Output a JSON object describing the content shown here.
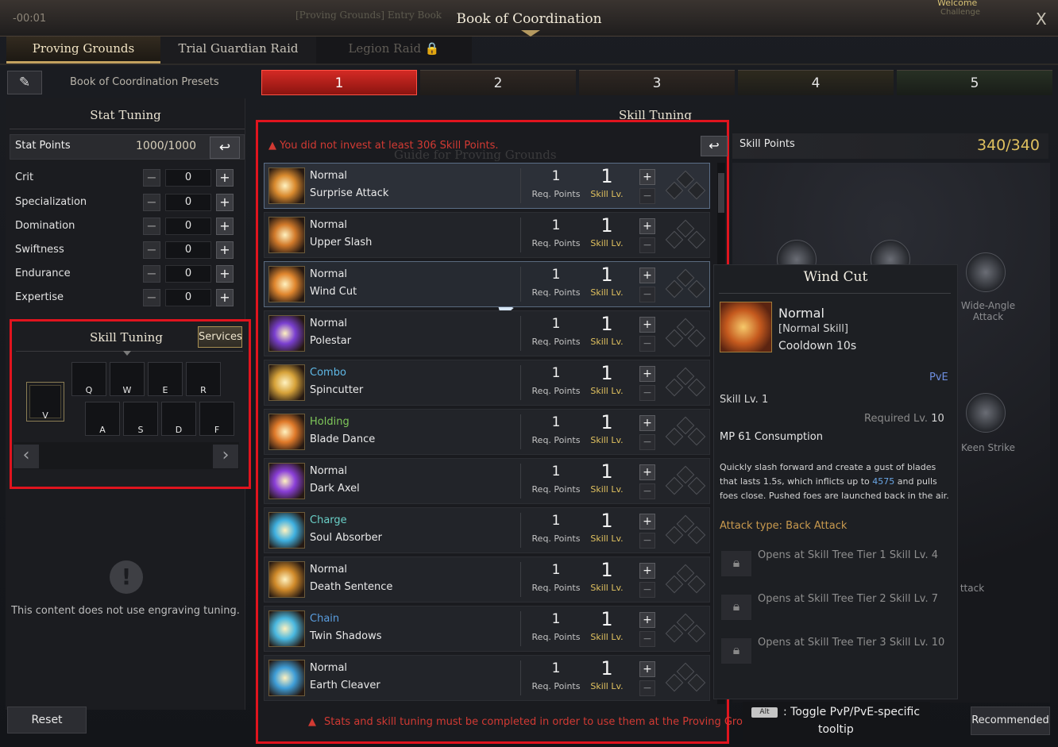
{
  "header": {
    "timer": "-00:01",
    "ghost_title": "[Proving Grounds] Entry Book",
    "title": "Book of Coordination",
    "welcome": "Welcome",
    "challenge": "Challenge",
    "close": "X"
  },
  "tabs": [
    {
      "label": "Proving Grounds"
    },
    {
      "label": "Trial Guardian Raid"
    },
    {
      "label": "Legion Raid 🔒"
    }
  ],
  "presets": {
    "label": "Book of Coordination Presets",
    "edit_icon": "pencil-edit-icon",
    "items": [
      "1",
      "2",
      "3",
      "4",
      "5"
    ],
    "selected": "1"
  },
  "stat_tuning": {
    "title": "Stat Tuning",
    "points_label": "Stat Points",
    "points_value": "1000/1000",
    "stats": [
      {
        "name": "Crit",
        "value": "0"
      },
      {
        "name": "Specialization",
        "value": "0"
      },
      {
        "name": "Domination",
        "value": "0"
      },
      {
        "name": "Swiftness",
        "value": "0"
      },
      {
        "name": "Endurance",
        "value": "0"
      },
      {
        "name": "Expertise",
        "value": "0"
      }
    ]
  },
  "left_skill_tuning": {
    "title": "Skill Tuning",
    "services": "Services",
    "keys_top": [
      "Q",
      "W",
      "E",
      "R"
    ],
    "keys_bottom": [
      "A",
      "S",
      "D",
      "F"
    ],
    "key_v": "V",
    "prev": "‹",
    "next": "›"
  },
  "engraving": {
    "message": "This content does not use engraving tuning.",
    "icon": "!"
  },
  "buttons": {
    "reset": "Reset",
    "recommended": "Recommended"
  },
  "skill_tuning": {
    "title": "Skill Tuning",
    "warning": "You did not invest at least 306 Skill Points.",
    "ghost_guide": "Guide for Proving Grounds",
    "bottom_warning": "Stats and skill tuning must be completed in order to use them at the Proving Grounds",
    "req_label": "Req. Points",
    "lv_label": "Skill Lv.",
    "skills": [
      {
        "type": "Normal",
        "type_color": "#e8e8e8",
        "name": "Surprise Attack",
        "req": "1",
        "lv": "1",
        "icon_color": "#d98a2e"
      },
      {
        "type": "Normal",
        "type_color": "#e8e8e8",
        "name": "Upper Slash",
        "req": "1",
        "lv": "1",
        "icon_color": "#d27a2a"
      },
      {
        "type": "Normal",
        "type_color": "#e8e8e8",
        "name": "Wind Cut",
        "req": "1",
        "lv": "1",
        "icon_color": "#e0862e"
      },
      {
        "type": "Normal",
        "type_color": "#e8e8e8",
        "name": "Polestar",
        "req": "1",
        "lv": "1",
        "icon_color": "#7a3fd0"
      },
      {
        "type": "Combo",
        "type_color": "#5fb8e6",
        "name": "Spincutter",
        "req": "1",
        "lv": "1",
        "icon_color": "#d7a33a"
      },
      {
        "type": "Holding",
        "type_color": "#7fc85a",
        "name": "Blade Dance",
        "req": "1",
        "lv": "1",
        "icon_color": "#e07a2a"
      },
      {
        "type": "Normal",
        "type_color": "#e8e8e8",
        "name": "Dark Axel",
        "req": "1",
        "lv": "1",
        "icon_color": "#8a3fd8"
      },
      {
        "type": "Charge",
        "type_color": "#6ad0c8",
        "name": "Soul Absorber",
        "req": "1",
        "lv": "1",
        "icon_color": "#3fb0e0"
      },
      {
        "type": "Normal",
        "type_color": "#e8e8e8",
        "name": "Death Sentence",
        "req": "1",
        "lv": "1",
        "icon_color": "#d08a2a"
      },
      {
        "type": "Chain",
        "type_color": "#5a9ee0",
        "name": "Twin Shadows",
        "req": "1",
        "lv": "1",
        "icon_color": "#4ab8e0"
      },
      {
        "type": "Normal",
        "type_color": "#e8e8e8",
        "name": "Earth Cleaver",
        "req": "1",
        "lv": "1",
        "icon_color": "#3f9ed8"
      }
    ]
  },
  "skill_points": {
    "label": "Skill Points",
    "value": "340/340"
  },
  "tree": {
    "labels": [
      "Wide-Angle\nAttack",
      "Keen Strike",
      "ttack"
    ]
  },
  "tooltip": {
    "title": "Wind Cut",
    "type": "Normal",
    "kind": "[Normal Skill]",
    "cooldown": "Cooldown 10s",
    "mode": "PvE",
    "skill_lv": "Skill Lv. 1",
    "required_prefix": "Required Lv.",
    "required_value": "10",
    "mp": "MP 61 Consumption",
    "desc_a": "Quickly slash forward and create a gust of blades that lasts 1.5s, which inflicts up to",
    "desc_num": "4575",
    "desc_b": "and pulls foes close. Pushed foes are launched back in the air.",
    "attack_type": "Attack type: Back Attack",
    "locks": [
      "Opens at Skill Tree Tier 1 Skill Lv. 4",
      "Opens at Skill Tree Tier 2 Skill Lv. 7",
      "Opens at Skill Tree Tier 3 Skill Lv. 10"
    ]
  },
  "alt_hint": {
    "key": "Alt",
    "text1": ": Toggle PvP/PvE-specific",
    "text2": "tooltip"
  }
}
